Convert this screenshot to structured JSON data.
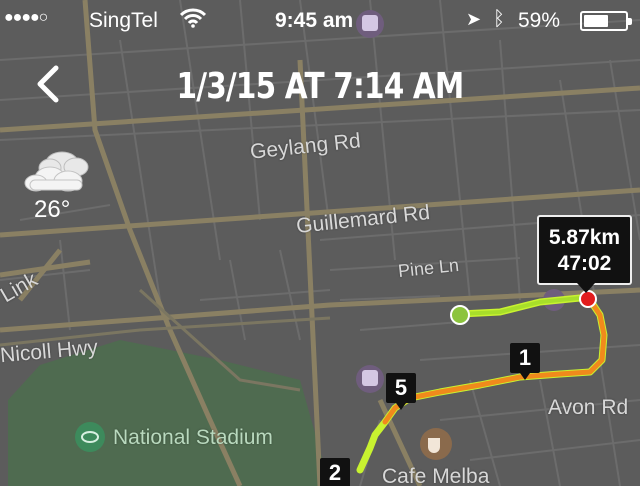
{
  "status": {
    "signal": "●●●●○",
    "carrier": "SingTel",
    "time": "9:45 am",
    "battery_text": "59%",
    "battery_level": 0.59
  },
  "header": {
    "title": "1/3/15 AT 7:14 AM",
    "back_icon": "chevron-left-icon"
  },
  "weather": {
    "temperature": "26°",
    "icon": "cloud-icon"
  },
  "map": {
    "street_labels": [
      "Geylang Rd",
      "Guillemard Rd",
      "Pine Ln",
      "Link",
      "Nicoll Hwy",
      "Avon Rd"
    ],
    "poi_labels": [
      "National Stadium",
      "Cafe Melba"
    ]
  },
  "run": {
    "distance": "5.87km",
    "duration": "47:02",
    "km_markers": [
      "1",
      "5",
      "2"
    ],
    "colors": {
      "start": "#8cc43d",
      "end": "#e21d1d",
      "fast": "#c6f22a",
      "slow": "#f08a1c"
    }
  }
}
